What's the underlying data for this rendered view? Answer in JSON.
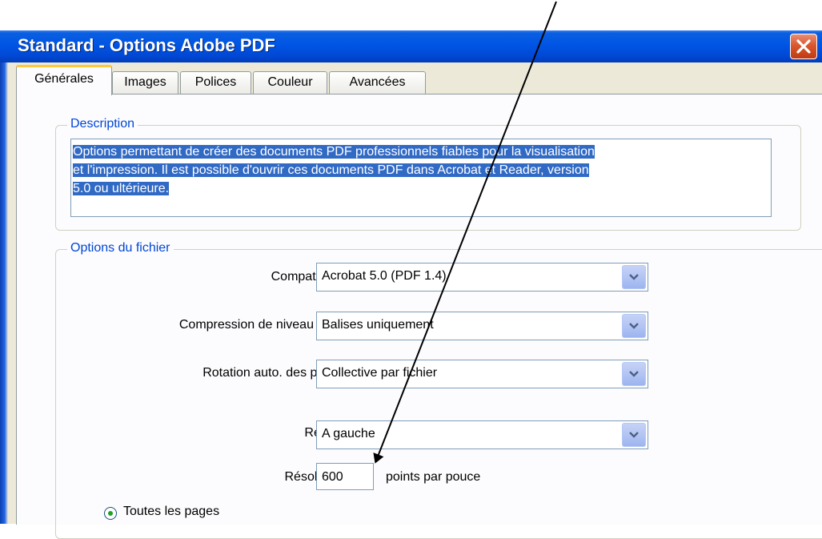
{
  "window": {
    "title": "Standard - Options Adobe PDF"
  },
  "tabs": [
    {
      "label": "Générales",
      "active": true
    },
    {
      "label": "Images"
    },
    {
      "label": "Polices"
    },
    {
      "label": "Couleur"
    },
    {
      "label": "Avancées"
    }
  ],
  "description": {
    "legend": "Description",
    "lines": [
      "Options permettant de créer des documents PDF professionnels fiables pour la visualisation",
      "et l'impression. Il est possible d'ouvrir ces documents PDF dans Acrobat et Reader, version",
      "5.0 ou ultérieure."
    ]
  },
  "file_options": {
    "legend": "Options du fichier",
    "compatibility": {
      "label": "Compatibilité :",
      "value": "Acrobat 5.0 (PDF 1.4)"
    },
    "compression": {
      "label": "Compression de niveau objet :",
      "value": "Balises uniquement"
    },
    "rotation": {
      "label": "Rotation auto. des pages :",
      "value": "Collective par fichier"
    },
    "binding": {
      "label": "Reliure :",
      "value": "A gauche"
    },
    "resolution": {
      "label": "Résolution :",
      "value": "600",
      "unit": "points par pouce"
    },
    "all_pages": {
      "label": "Toutes les pages",
      "checked": true
    }
  },
  "colors": {
    "accent": "#0046d5",
    "selection": "#316ac5",
    "titlebar": "#0055e5",
    "close": "#d9582f",
    "active_tab": "#ffc83c"
  }
}
